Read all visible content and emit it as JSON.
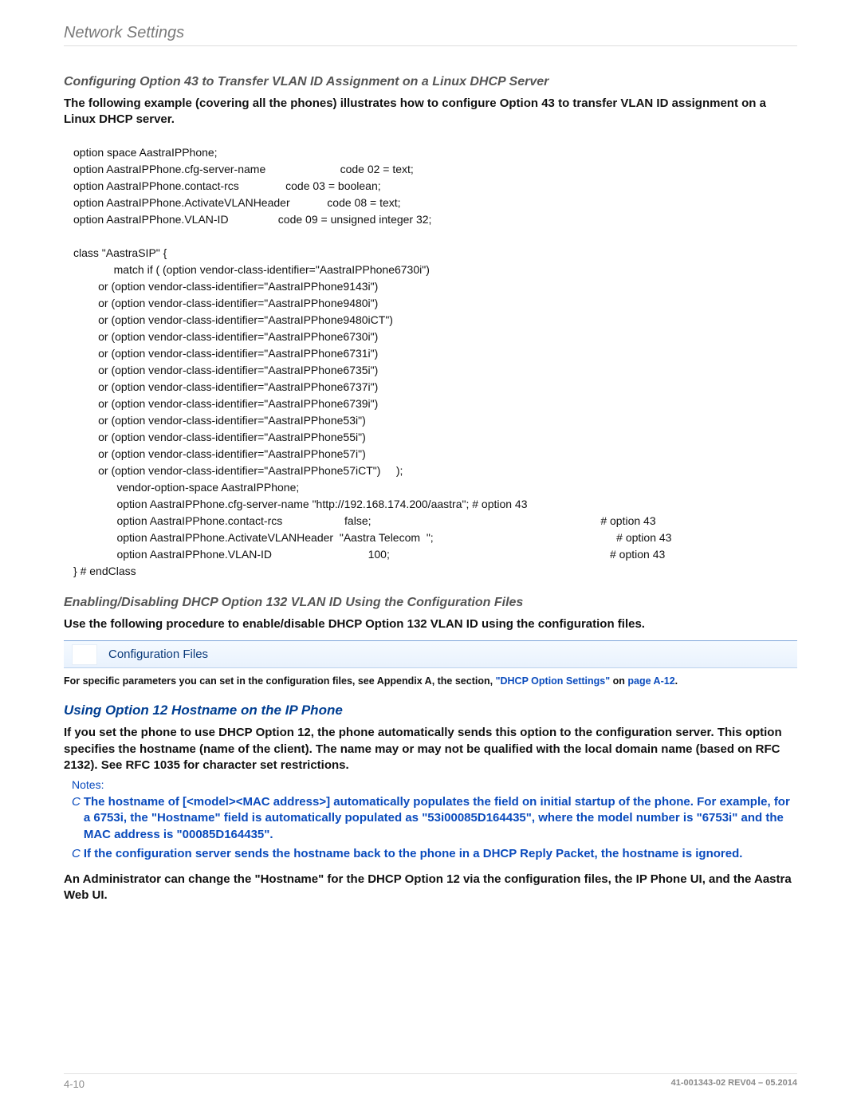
{
  "header": {
    "title": "Network Settings"
  },
  "section1": {
    "heading": "Configuring Option 43 to Transfer VLAN ID Assignment on a Linux DHCP Server",
    "intro": "The following example (covering all the phones) illustrates how to configure Option 43 to transfer VLAN ID assignment on a Linux DHCP server.",
    "code": "option space AastraIPPhone;\noption AastraIPPhone.cfg-server-name                        code 02 = text;\noption AastraIPPhone.contact-rcs               code 03 = boolean;\noption AastraIPPhone.ActivateVLANHeader            code 08 = text;\noption AastraIPPhone.VLAN-ID                code 09 = unsigned integer 32;\n\nclass \"AastraSIP\" {\n             match if ( (option vendor-class-identifier=\"AastraIPPhone6730i\")\n        or (option vendor-class-identifier=\"AastraIPPhone9143i\")\n        or (option vendor-class-identifier=\"AastraIPPhone9480i\")\n        or (option vendor-class-identifier=\"AastraIPPhone9480iCT\")\n        or (option vendor-class-identifier=\"AastraIPPhone6730i\")\n        or (option vendor-class-identifier=\"AastraIPPhone6731i\")\n        or (option vendor-class-identifier=\"AastraIPPhone6735i\")\n        or (option vendor-class-identifier=\"AastraIPPhone6737i\")\n        or (option vendor-class-identifier=\"AastraIPPhone6739i\")\n        or (option vendor-class-identifier=\"AastraIPPhone53i\")\n        or (option vendor-class-identifier=\"AastraIPPhone55i\")\n        or (option vendor-class-identifier=\"AastraIPPhone57i\")\n        or (option vendor-class-identifier=\"AastraIPPhone57iCT\")     );\n              vendor-option-space AastraIPPhone;\n              option AastraIPPhone.cfg-server-name \"http://192.168.174.200/aastra\"; # option 43\n              option AastraIPPhone.contact-rcs                    false;                                                                          # option 43\n              option AastraIPPhone.ActivateVLANHeader  \"Aastra Telecom  \";                                                           # option 43\n              option AastraIPPhone.VLAN-ID                               100;                                                                       # option 43\n} # endClass"
  },
  "section2": {
    "heading": "Enabling/Disabling DHCP Option 132 VLAN ID Using the Configuration Files",
    "intro": "Use the following procedure to enable/disable DHCP Option 132 VLAN ID using the configuration files.",
    "callout_label": "Configuration Files",
    "appendix_pre": "For specific parameters you can set in the configuration files, see Appendix A, the section, ",
    "appendix_link1": "\"DHCP Option Settings\"",
    "appendix_mid": " on ",
    "appendix_link2": "page A-12",
    "appendix_post": "."
  },
  "section3": {
    "heading": "Using Option 12 Hostname on the IP Phone",
    "body": "If you set the phone to use DHCP Option 12, the phone automatically sends this option to the configuration server. This option specifies the hostname (name of the client). The name may or may not be qualified with the local domain name (based on RFC 2132). See RFC 1035 for character set restrictions.",
    "notes_title": "Notes:",
    "notes": [
      "The hostname of [<model><MAC address>] automatically populates the field on initial startup of the phone. For example, for a 6753i, the \"Hostname\" field is automatically populated as \"53i00085D164435\", where the model number is \"6753i\" and the MAC address is \"00085D164435\".",
      "If the configuration server sends the hostname back to the phone in a DHCP Reply Packet, the hostname is ignored."
    ],
    "closing": "An Administrator can change the \"Hostname\" for the DHCP Option 12 via the configuration files, the IP Phone UI, and the Aastra Web UI."
  },
  "footer": {
    "page_number": "4-10",
    "docref": "41-001343-02 REV04 – 05.2014"
  }
}
